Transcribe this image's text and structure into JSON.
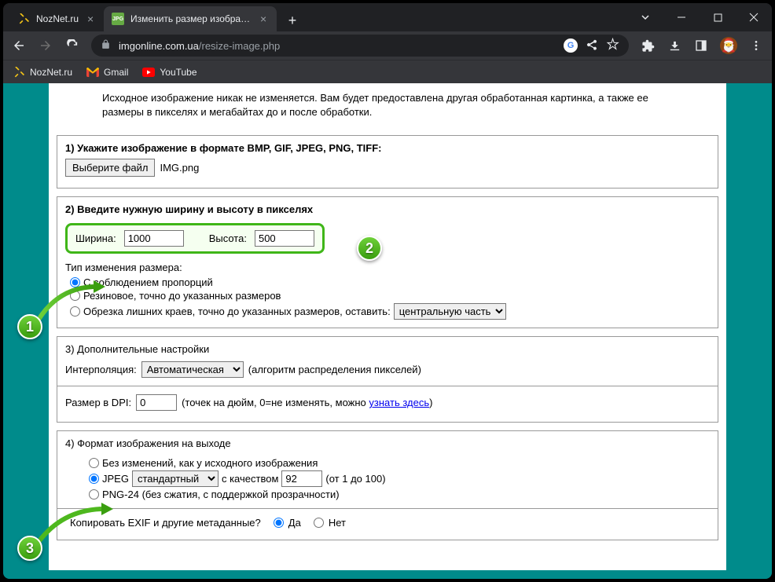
{
  "tabs": [
    {
      "title": "NozNet.ru",
      "active": false
    },
    {
      "title": "Изменить размер изображения",
      "active": true
    }
  ],
  "url": {
    "domain": "imgonline.com.ua",
    "path": "/resize-image.php"
  },
  "bookmarks": [
    "NozNet.ru",
    "Gmail",
    "YouTube"
  ],
  "intro": "Исходное изображение никак не изменяется. Вам будет предоставлена другая обработанная картинка, а также ее размеры в пикселях и мегабайтах до и после обработки.",
  "s1": {
    "title": "1) Укажите изображение в формате BMP, GIF, JPEG, PNG, TIFF:",
    "filebtn": "Выберите файл",
    "filename": "IMG.png"
  },
  "s2": {
    "title": "2) Введите нужную ширину и высоту в пикселях",
    "width_label": "Ширина:",
    "width": "1000",
    "height_label": "Высота:",
    "height": "500",
    "type_label": "Тип изменения размера:",
    "opt1": "С соблюдением пропорций",
    "opt2": "Резиновое, точно до указанных размеров",
    "opt3_a": "Обрезка лишних краев, точно до указанных размеров, оставить:",
    "opt3_select": "центральную часть"
  },
  "s3": {
    "title": "3) Дополнительные настройки",
    "interp_label": "Интерполяция:",
    "interp_value": "Автоматическая",
    "interp_note": "(алгоритм распределения пикселей)",
    "dpi_label": "Размер в DPI:",
    "dpi_value": "0",
    "dpi_note_a": "(точек на дюйм, 0=не изменять, можно ",
    "dpi_link": "узнать здесь",
    "dpi_note_b": ")"
  },
  "s4": {
    "title": "4) Формат изображения на выходе",
    "opt1": "Без изменений, как у исходного изображения",
    "opt2_a": "JPEG",
    "opt2_select": "стандартный",
    "opt2_b": "с качеством",
    "opt2_q": "92",
    "opt2_c": "(от 1 до 100)",
    "opt3": "PNG-24 (без сжатия, с поддержкой прозрачности)",
    "exif_label": "Копировать EXIF и другие метаданные?",
    "yes": "Да",
    "no": "Нет"
  },
  "badges": {
    "b1": "1",
    "b2": "2",
    "b3": "3"
  }
}
